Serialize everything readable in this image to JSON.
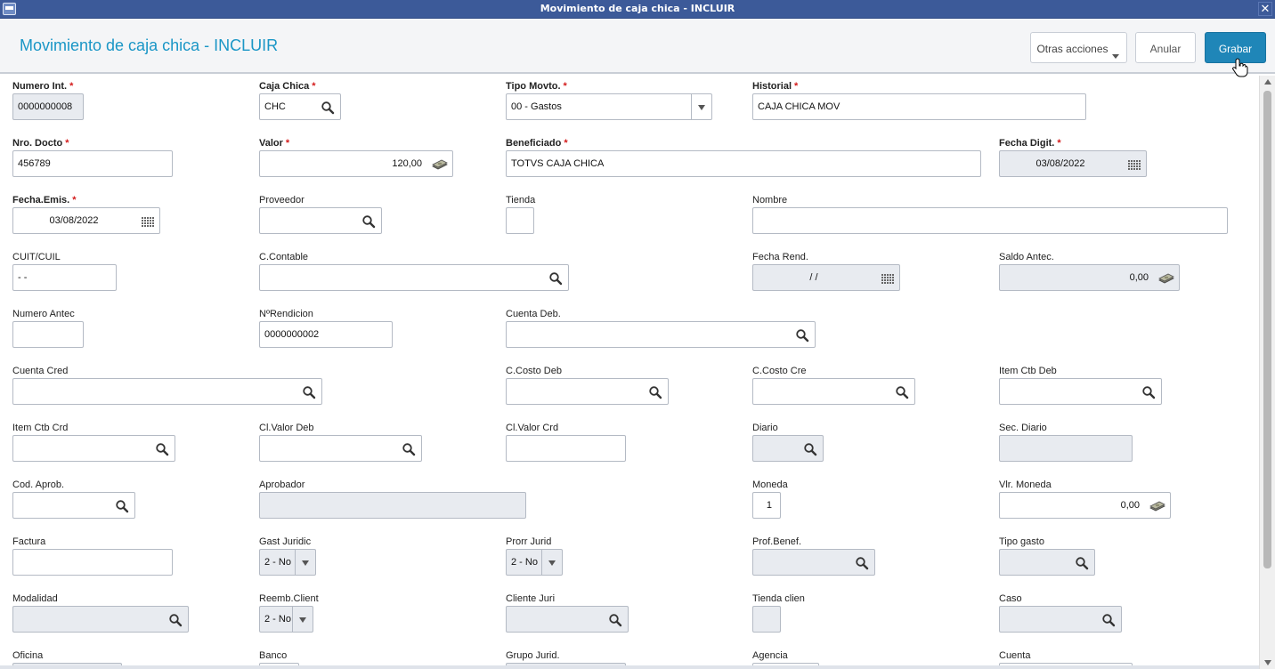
{
  "window": {
    "title": "Movimiento de caja chica - INCLUIR"
  },
  "header": {
    "page_title": "Movimiento de caja chica - INCLUIR",
    "other_actions": "Otras acciones",
    "cancel": "Anular",
    "save": "Grabar"
  },
  "fields": {
    "numero_int": {
      "label": "Numero Int.",
      "value": "0000000008"
    },
    "caja_chica": {
      "label": "Caja Chica",
      "value": "CHC"
    },
    "tipo_movto": {
      "label": "Tipo Movto.",
      "value": "00 - Gastos"
    },
    "historial": {
      "label": "Historial",
      "value": "CAJA CHICA MOV"
    },
    "nro_docto": {
      "label": "Nro. Docto",
      "value": "456789"
    },
    "valor": {
      "label": "Valor",
      "value": "120,00"
    },
    "beneficiado": {
      "label": "Beneficiado",
      "value": "TOTVS CAJA CHICA"
    },
    "fecha_digit": {
      "label": "Fecha Digit.",
      "value": "03/08/2022"
    },
    "fecha_emis": {
      "label": "Fecha.Emis.",
      "value": "03/08/2022"
    },
    "proveedor": {
      "label": "Proveedor",
      "value": ""
    },
    "tienda": {
      "label": "Tienda",
      "value": ""
    },
    "nombre": {
      "label": "Nombre",
      "value": ""
    },
    "cuit_cuil": {
      "label": "CUIT/CUIL",
      "value": "-        -"
    },
    "c_contable": {
      "label": "C.Contable",
      "value": ""
    },
    "fecha_rend": {
      "label": "Fecha Rend.",
      "value": "/  /"
    },
    "saldo_antec": {
      "label": "Saldo Antec.",
      "value": "0,00"
    },
    "numero_antec": {
      "label": "Numero Antec",
      "value": ""
    },
    "n_rendicion": {
      "label": "NºRendicion",
      "value": "0000000002"
    },
    "cuenta_deb": {
      "label": "Cuenta Deb.",
      "value": ""
    },
    "cuenta_cred": {
      "label": "Cuenta Cred",
      "value": ""
    },
    "c_costo_deb": {
      "label": "C.Costo Deb",
      "value": ""
    },
    "c_costo_cre": {
      "label": "C.Costo Cre",
      "value": ""
    },
    "item_ctb_deb": {
      "label": "Item Ctb Deb",
      "value": ""
    },
    "item_ctb_crd": {
      "label": "Item Ctb Crd",
      "value": ""
    },
    "cl_valor_deb": {
      "label": "Cl.Valor Deb",
      "value": ""
    },
    "cl_valor_crd": {
      "label": "Cl.Valor Crd",
      "value": ""
    },
    "diario": {
      "label": "Diario",
      "value": ""
    },
    "sec_diario": {
      "label": "Sec. Diario",
      "value": ""
    },
    "cod_aprob": {
      "label": "Cod. Aprob.",
      "value": ""
    },
    "aprobador": {
      "label": "Aprobador",
      "value": ""
    },
    "moneda": {
      "label": "Moneda",
      "value": "1"
    },
    "vlr_moneda": {
      "label": "Vlr. Moneda",
      "value": "0,00"
    },
    "factura": {
      "label": "Factura",
      "value": ""
    },
    "gast_juridic": {
      "label": "Gast Juridic",
      "value": "2 - No"
    },
    "prorr_jurid": {
      "label": "Prorr Jurid",
      "value": "2 - No"
    },
    "prof_benef": {
      "label": "Prof.Benef.",
      "value": ""
    },
    "tipo_gasto": {
      "label": "Tipo gasto",
      "value": ""
    },
    "modalidad": {
      "label": "Modalidad",
      "value": ""
    },
    "reemb_client": {
      "label": "Reemb.Client",
      "value": "2 - No"
    },
    "cliente_juri": {
      "label": "Cliente Juri",
      "value": ""
    },
    "tienda_clien": {
      "label": "Tienda clien",
      "value": ""
    },
    "caso": {
      "label": "Caso",
      "value": ""
    },
    "oficina": {
      "label": "Oficina",
      "value": ""
    },
    "banco": {
      "label": "Banco",
      "value": ""
    },
    "grupo_jurid": {
      "label": "Grupo Jurid.",
      "value": ""
    },
    "agencia": {
      "label": "Agencia",
      "value": ""
    },
    "cuenta": {
      "label": "Cuenta",
      "value": ""
    }
  },
  "icons": {
    "search": "magnifier-icon",
    "calendar": "calendar-icon",
    "money": "money-icon",
    "dropdown": "chevron-down-icon"
  },
  "colors": {
    "title_blue": "#1a96c6",
    "primary_button": "#1f86b8",
    "required_star": "#d31a1a",
    "titlebar": "#3c5a99"
  }
}
